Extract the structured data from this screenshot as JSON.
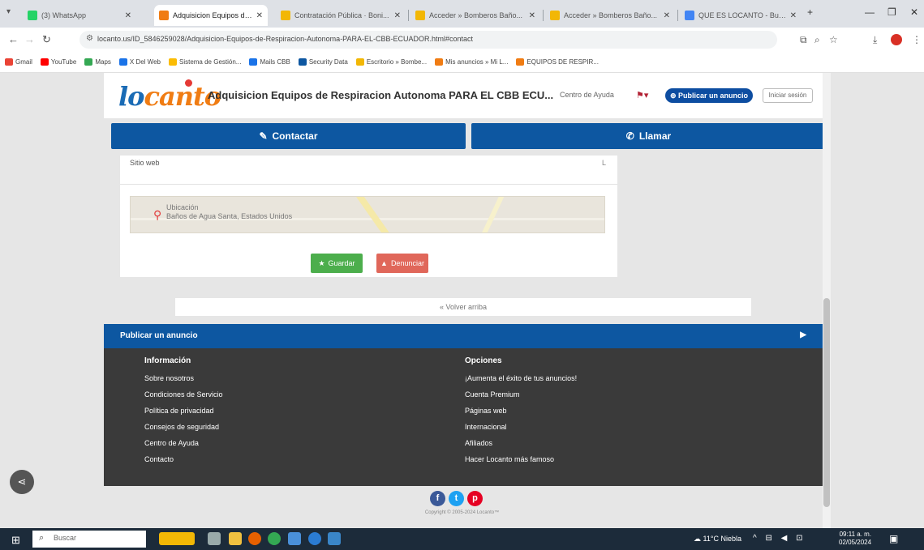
{
  "browser": {
    "tabs": [
      {
        "label": "(3) WhatsApp",
        "color": "#25d366"
      },
      {
        "label": "Adquisicion Equipos de Res...",
        "color": "#f07c13"
      },
      {
        "label": "Contratación Pública · Boni...",
        "color": "#f2b705"
      },
      {
        "label": "Acceder » Bomberos Baño...",
        "color": "#f2b705"
      },
      {
        "label": "Acceder » Bomberos Baño...",
        "color": "#f2b705"
      },
      {
        "label": "QUE ES LOCANTO - Busca...",
        "color": "#4285f4"
      }
    ],
    "url": "locanto.us/ID_5846259028/Adquisicion-Equipos-de-Respiracion-Autonoma-PARA-EL-CBB-ECUADOR.html#contact",
    "bookmarks": [
      {
        "label": "Gmail",
        "color": "#ea4335"
      },
      {
        "label": "YouTube",
        "color": "#ff0000"
      },
      {
        "label": "Maps",
        "color": "#34a853"
      },
      {
        "label": "X Del Web",
        "color": "#1a73e8"
      },
      {
        "label": "Sistema de Gestión...",
        "color": "#fbbc04"
      },
      {
        "label": "Mails CBB",
        "color": "#1a73e8"
      },
      {
        "label": "Security Data",
        "color": "#0d57a1"
      },
      {
        "label": "Escritorio » Bombe...",
        "color": "#f2b705"
      },
      {
        "label": "Mis anuncios » Mi L...",
        "color": "#f07c13"
      },
      {
        "label": "EQUIPOS DE RESPIR...",
        "color": "#f07c13"
      }
    ]
  },
  "header": {
    "logo_part1": "lo",
    "logo_part2": "canto",
    "ad_title": "Adquisicion Equipos de Respiracion Autonoma PARA EL CBB ECU...",
    "help_link": "Centro de Ayuda",
    "publish_button": "Publicar un anuncio",
    "login_button": "Iniciar sesión"
  },
  "actions": {
    "contact": "Contactar",
    "call": "Llamar"
  },
  "details": {
    "website_label": "Sitio web",
    "website_value": "L",
    "location_label": "Ubicación",
    "location_value": "Baños de Agua Santa, Estados Unidos",
    "save_button": "Guardar",
    "report_button": "Denunciar"
  },
  "back_link": "« Volver arriba",
  "publish_bar": "Publicar un anuncio",
  "footer": {
    "info_heading": "Información",
    "info_links": [
      "Sobre nosotros",
      "Condiciones de Servicio",
      "Política de privacidad",
      "Consejos de seguridad",
      "Centro de Ayuda",
      "Contacto"
    ],
    "options_heading": "Opciones",
    "options_links": [
      "¡Aumenta el éxito de tus anuncios!",
      "Cuenta Premium",
      "Páginas web",
      "Internacional",
      "Afiliados",
      "Hacer Locanto más famoso"
    ],
    "copyright": "Copyright © 2005-2024 Locanto™"
  },
  "taskbar": {
    "search_placeholder": "Buscar",
    "weather": "11°C Niebla",
    "time": "09:11 a. m.",
    "date": "02/05/2024"
  },
  "colors": {
    "brand_blue": "#0d57a1",
    "brand_orange": "#f07c13",
    "footer_bg": "#3a3a3a",
    "save_green": "#4cae4c",
    "report_red": "#e0675a"
  }
}
